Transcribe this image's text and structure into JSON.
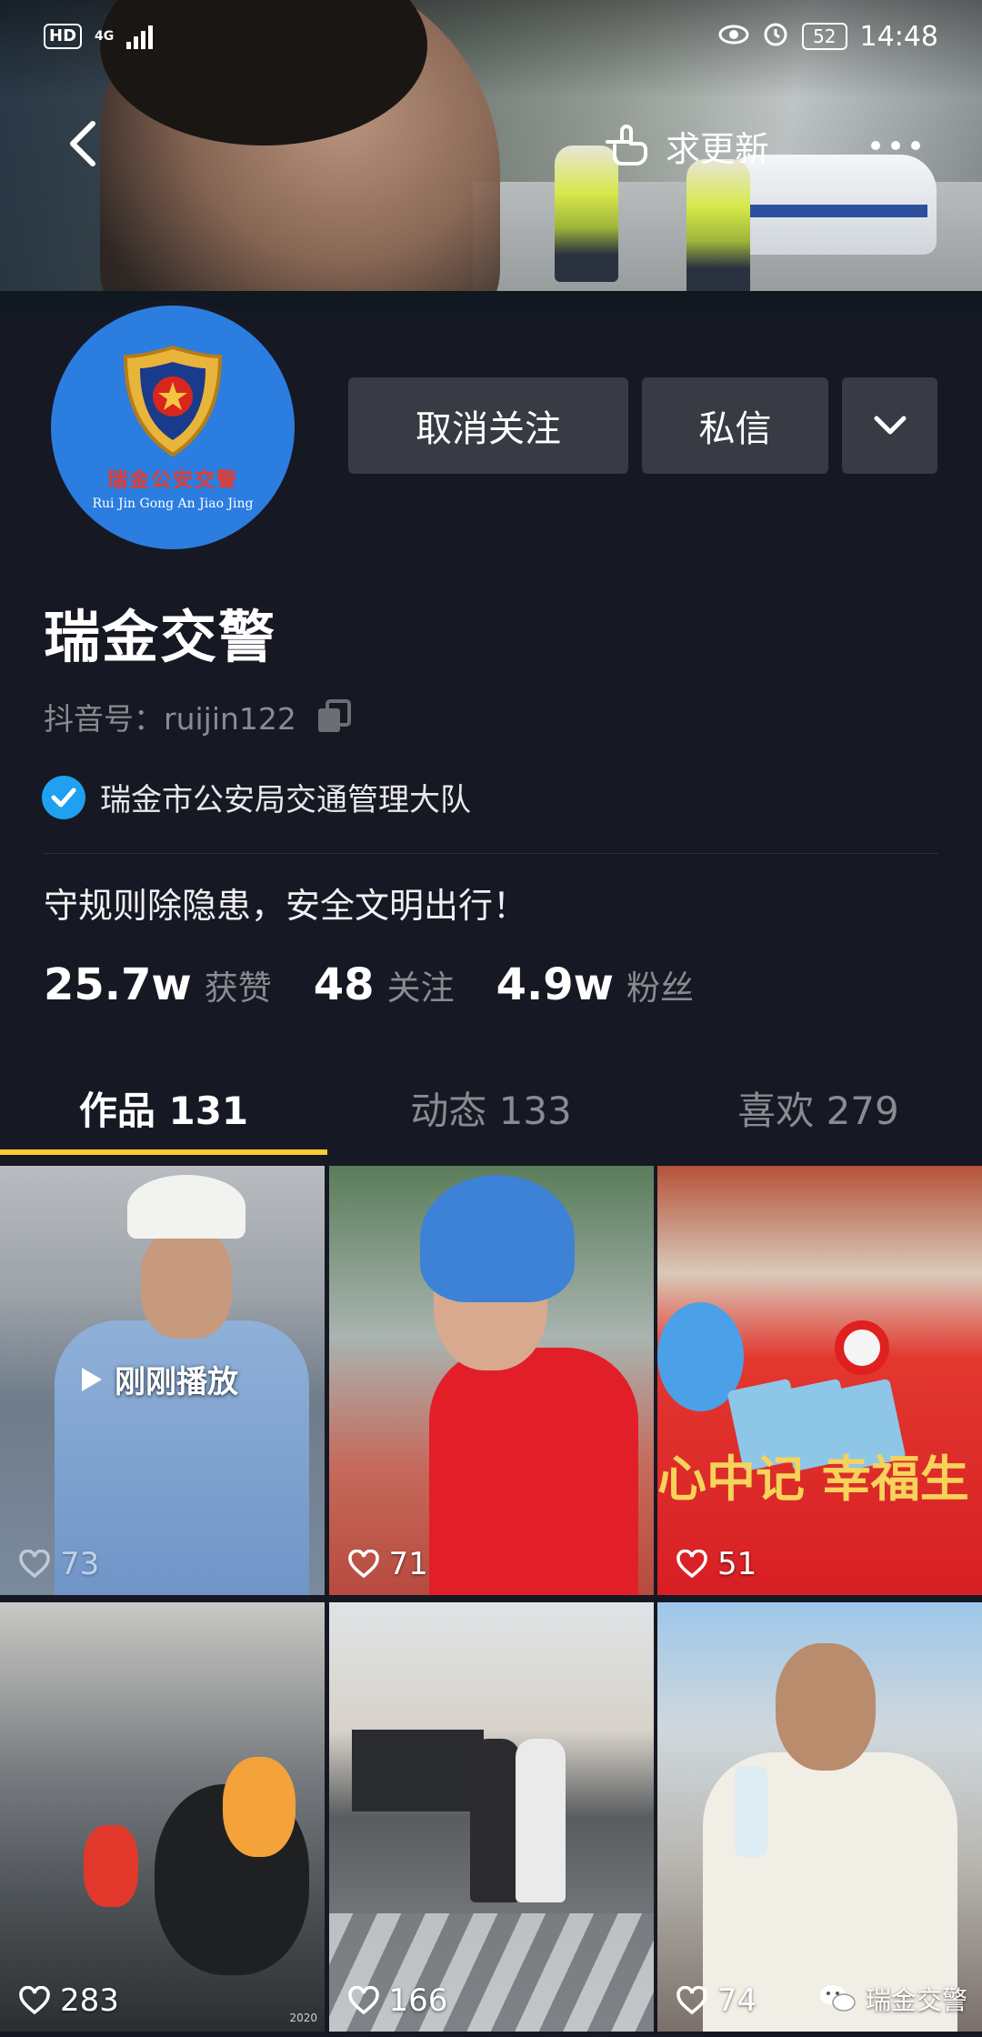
{
  "status_bar": {
    "hd": "HD",
    "network": "4G",
    "battery": "52",
    "time": "14:48"
  },
  "top_nav": {
    "request_update_label": "求更新"
  },
  "avatar": {
    "text_cn": "瑞金公安交警",
    "text_en": "Rui Jin Gong An Jiao Jing"
  },
  "actions": {
    "unfollow_label": "取消关注",
    "message_label": "私信"
  },
  "profile": {
    "name": "瑞金交警",
    "douyin_id": "抖音号：ruijin122",
    "verification": "瑞金市公安局交通管理大队",
    "bio": "守规则除隐患，安全文明出行！"
  },
  "stats": [
    {
      "value": "25.7w",
      "label": "获赞"
    },
    {
      "value": "48",
      "label": "关注"
    },
    {
      "value": "4.9w",
      "label": "粉丝"
    }
  ],
  "tabs": [
    {
      "label": "作品 131",
      "active": true
    },
    {
      "label": "动态 133",
      "active": false
    },
    {
      "label": "喜欢 279",
      "active": false
    }
  ],
  "videos": [
    {
      "likes": "73",
      "overlay": "刚刚播放"
    },
    {
      "likes": "71"
    },
    {
      "likes": "51",
      "banner_text": "心中记  幸福生"
    },
    {
      "likes": "283",
      "stamp": "2020"
    },
    {
      "likes": "166"
    },
    {
      "likes": "74"
    }
  ],
  "watermark": "瑞金交警",
  "colors": {
    "background": "#161823",
    "button": "#393b44",
    "tab_indicator": "#fccb2e",
    "verify_badge": "#20a0f0"
  },
  "icons": [
    "back-arrow-icon",
    "hand-pointer-icon",
    "more-dots-icon",
    "chevron-down-icon",
    "copy-icon",
    "verified-check-icon",
    "heart-icon",
    "play-icon",
    "wechat-icon"
  ]
}
